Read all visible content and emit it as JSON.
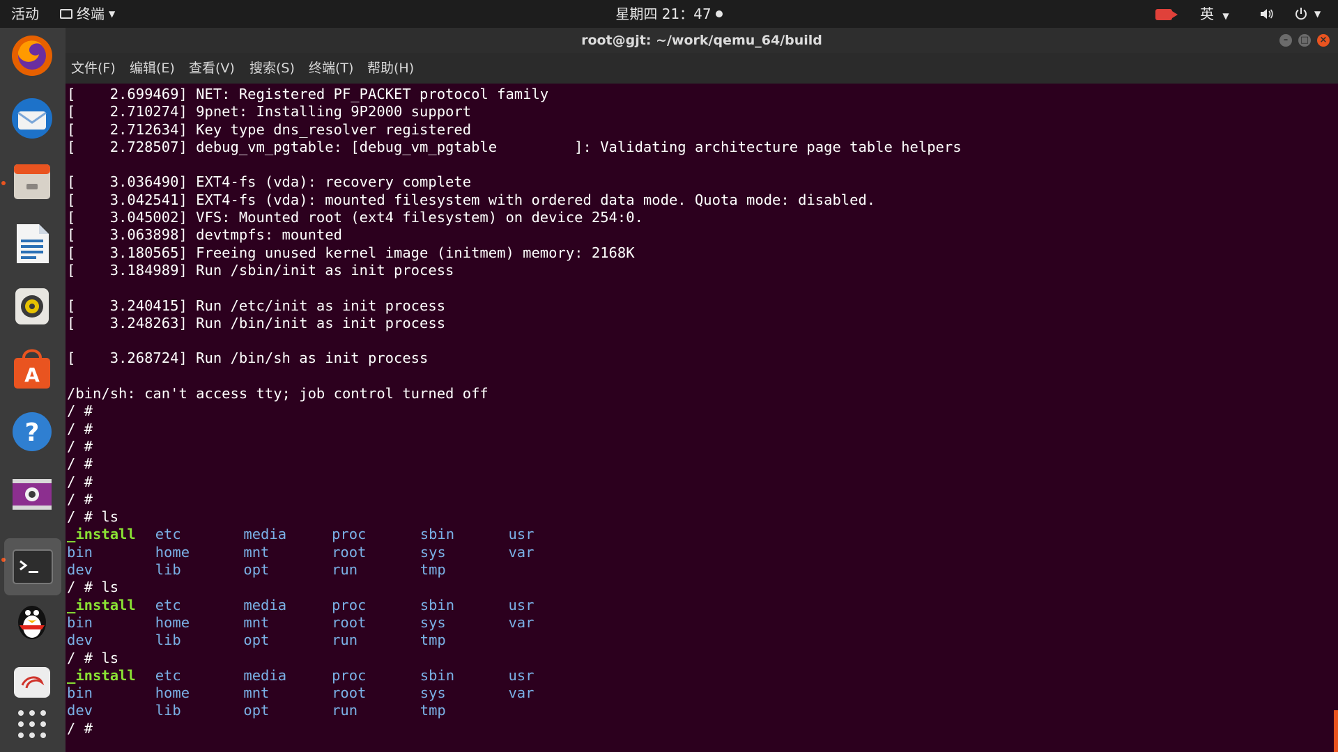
{
  "topbar": {
    "activities": "活动",
    "app_name": "终端",
    "clock": "星期四 21：47",
    "input_method": "英"
  },
  "dock": {
    "items": [
      {
        "name": "firefox-icon"
      },
      {
        "name": "thunderbird-icon"
      },
      {
        "name": "files-icon"
      },
      {
        "name": "writer-icon"
      },
      {
        "name": "rhythmbox-icon"
      },
      {
        "name": "software-center-icon"
      },
      {
        "name": "help-icon"
      },
      {
        "name": "screen-recorder-icon"
      },
      {
        "name": "terminal-icon"
      },
      {
        "name": "qq-icon"
      },
      {
        "name": "media-icon"
      },
      {
        "name": "show-apps-icon"
      }
    ]
  },
  "window": {
    "title": "root@gjt: ~/work/qemu_64/build",
    "menus": [
      "文件(F)",
      "编辑(E)",
      "查看(V)",
      "搜索(S)",
      "终端(T)",
      "帮助(H)"
    ]
  },
  "terminal": {
    "lines": [
      {
        "t": "[    2.699469] NET: Registered PF_PACKET protocol family"
      },
      {
        "t": "[    2.710274] 9pnet: Installing 9P2000 support"
      },
      {
        "t": "[    2.712634] Key type dns_resolver registered"
      },
      {
        "t": "[    2.728507] debug_vm_pgtable: [debug_vm_pgtable         ]: Validating architecture page table helpers"
      },
      {
        "t": ""
      },
      {
        "t": "[    3.036490] EXT4-fs (vda): recovery complete"
      },
      {
        "t": "[    3.042541] EXT4-fs (vda): mounted filesystem with ordered data mode. Quota mode: disabled."
      },
      {
        "t": "[    3.045002] VFS: Mounted root (ext4 filesystem) on device 254:0."
      },
      {
        "t": "[    3.063898] devtmpfs: mounted"
      },
      {
        "t": "[    3.180565] Freeing unused kernel image (initmem) memory: 2168K"
      },
      {
        "t": "[    3.184989] Run /sbin/init as init process"
      },
      {
        "t": ""
      },
      {
        "t": "[    3.240415] Run /etc/init as init process"
      },
      {
        "t": "[    3.248263] Run /bin/init as init process"
      },
      {
        "t": ""
      },
      {
        "t": "[    3.268724] Run /bin/sh as init process"
      },
      {
        "t": ""
      },
      {
        "t": "/bin/sh: can't access tty; job control turned off"
      },
      {
        "t": "/ #"
      },
      {
        "t": "/ #"
      },
      {
        "t": "/ #"
      },
      {
        "t": "/ #"
      },
      {
        "t": "/ #"
      },
      {
        "t": "/ #"
      },
      {
        "t": "/ # ls"
      },
      {
        "ls": [
          "_install",
          "etc",
          "media",
          "proc",
          "sbin",
          "usr"
        ]
      },
      {
        "ls": [
          "bin",
          "home",
          "mnt",
          "root",
          "sys",
          "var"
        ]
      },
      {
        "ls": [
          "dev",
          "lib",
          "opt",
          "run",
          "tmp"
        ]
      },
      {
        "t": "/ # ls"
      },
      {
        "ls": [
          "_install",
          "etc",
          "media",
          "proc",
          "sbin",
          "usr"
        ]
      },
      {
        "ls": [
          "bin",
          "home",
          "mnt",
          "root",
          "sys",
          "var"
        ]
      },
      {
        "ls": [
          "dev",
          "lib",
          "opt",
          "run",
          "tmp"
        ]
      },
      {
        "t": "/ # ls"
      },
      {
        "ls": [
          "_install",
          "etc",
          "media",
          "proc",
          "sbin",
          "usr"
        ]
      },
      {
        "ls": [
          "bin",
          "home",
          "mnt",
          "root",
          "sys",
          "var"
        ]
      },
      {
        "ls": [
          "dev",
          "lib",
          "opt",
          "run",
          "tmp"
        ]
      },
      {
        "t": "/ #"
      }
    ],
    "executable_entries": [
      "_install"
    ]
  },
  "colors": {
    "terminal_bg": "#2c001e",
    "directory": "#7ab0e6",
    "executable": "#8ae234",
    "accent": "#e95420"
  }
}
